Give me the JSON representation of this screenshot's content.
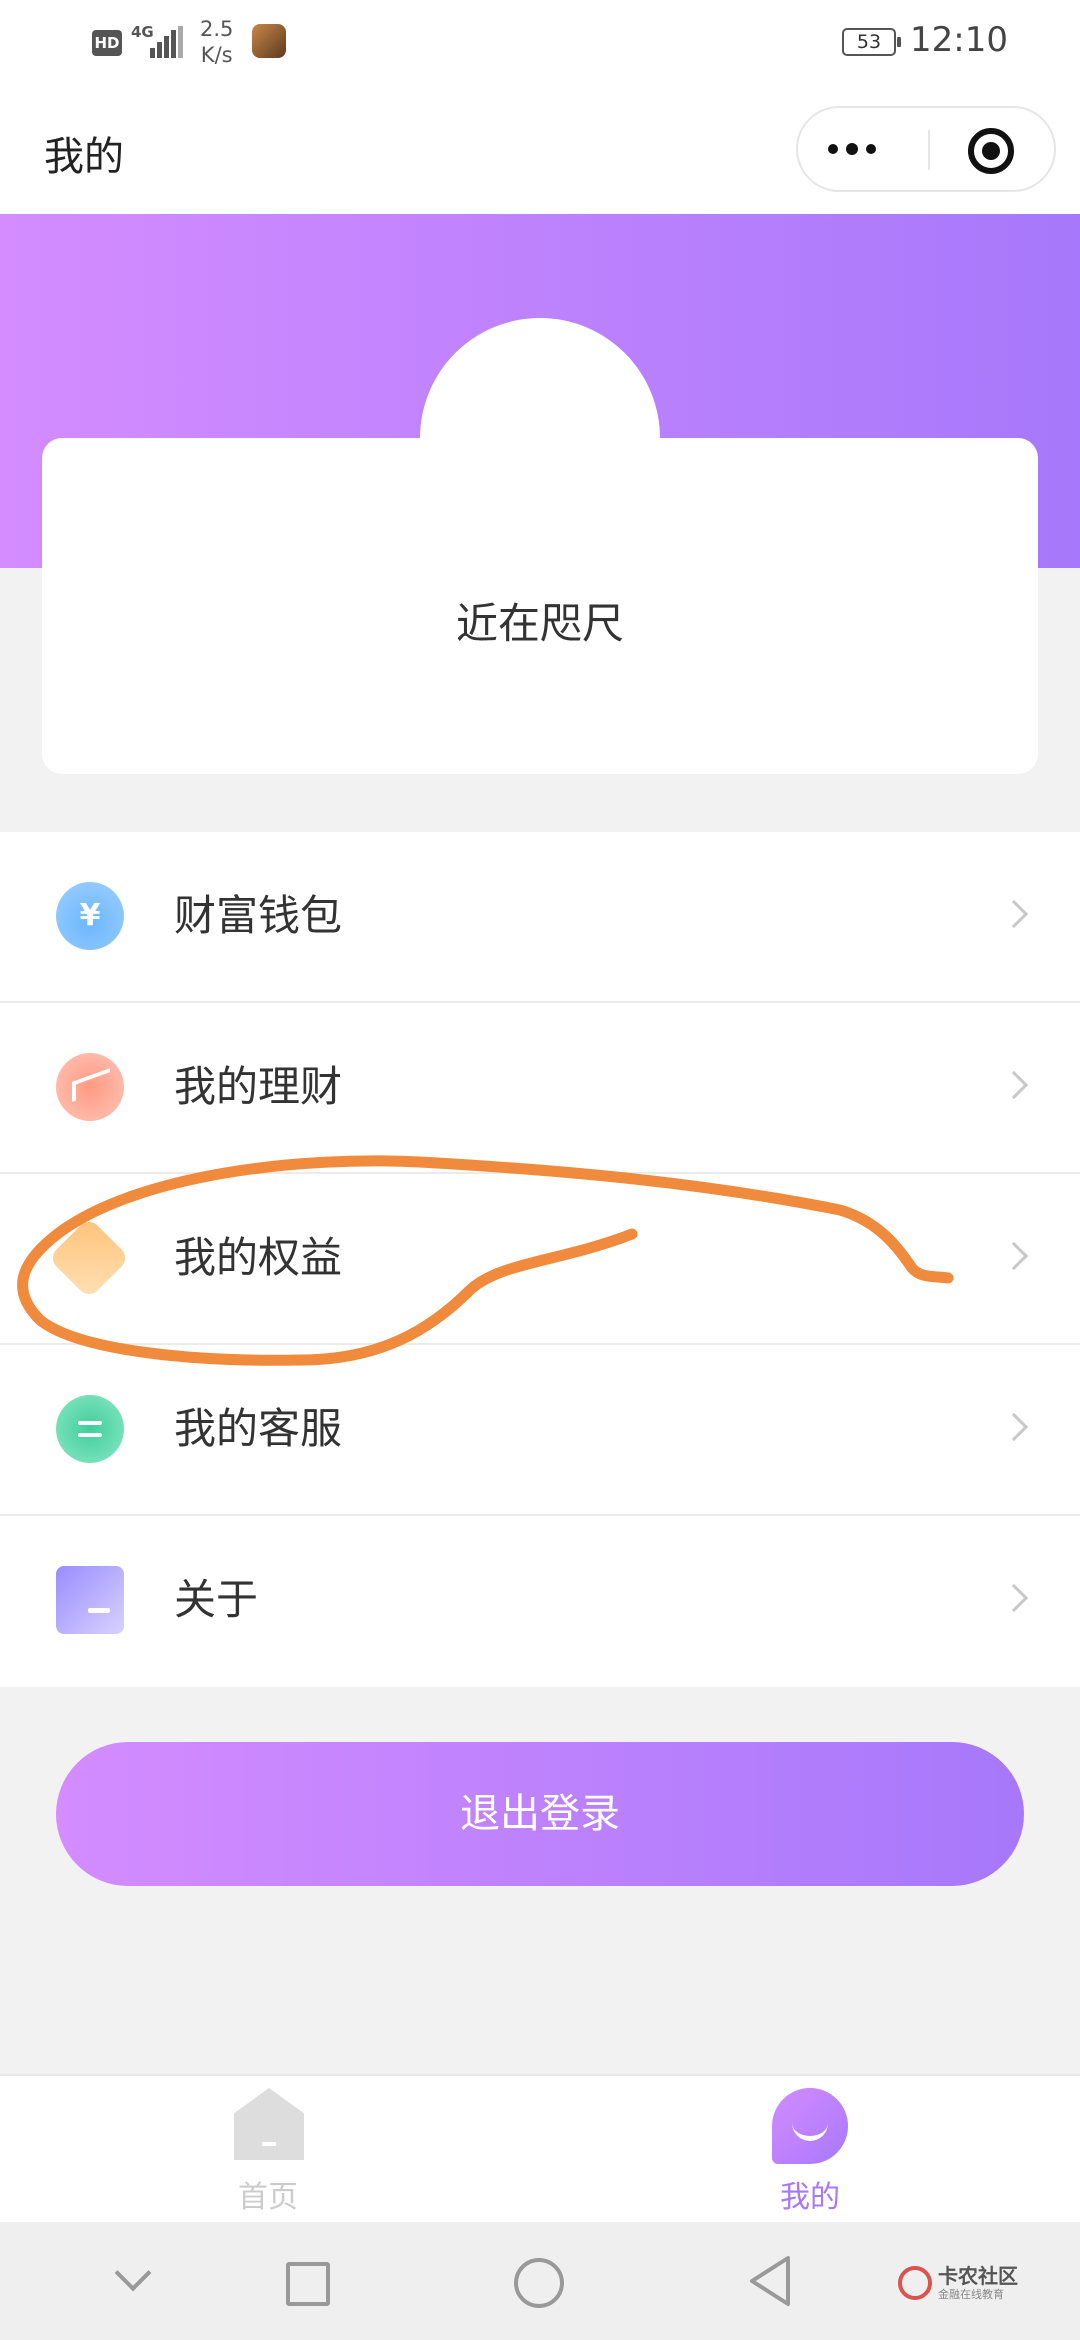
{
  "status_bar": {
    "hd": "HD",
    "network": "4G",
    "speed_value": "2.5",
    "speed_unit": "K/s",
    "battery": "53",
    "time": "12:10"
  },
  "nav": {
    "title": "我的"
  },
  "profile": {
    "nickname": "近在咫尺"
  },
  "menu": {
    "items": [
      {
        "label": "财富钱包",
        "icon": "wallet-icon"
      },
      {
        "label": "我的理财",
        "icon": "finance-icon"
      },
      {
        "label": "我的权益",
        "icon": "rights-icon"
      },
      {
        "label": "我的客服",
        "icon": "service-icon"
      },
      {
        "label": "关于",
        "icon": "about-icon"
      }
    ]
  },
  "logout": {
    "label": "退出登录"
  },
  "tabbar": {
    "home": "首页",
    "me": "我的"
  },
  "watermark": {
    "title": "卡农社区",
    "subtitle": "金融在线教育"
  },
  "colors": {
    "accent_start": "#d48cff",
    "accent_end": "#a778fb",
    "annotation": "#f08a3c",
    "tab_active": "#a778fb",
    "tab_inactive": "#cccccc"
  }
}
